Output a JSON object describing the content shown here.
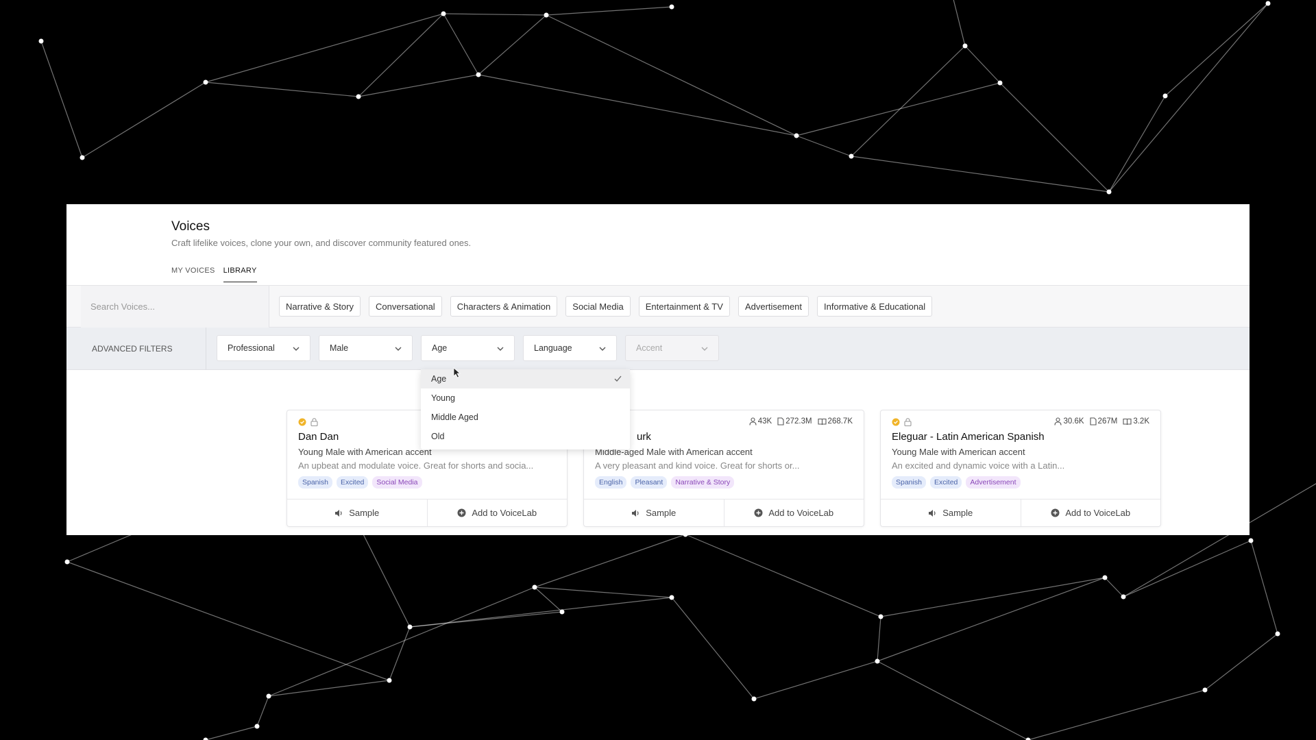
{
  "header": {
    "title": "Voices",
    "subtitle": "Craft lifelike voices, clone your own, and discover community featured ones."
  },
  "tabs": [
    {
      "label": "MY VOICES",
      "active": false
    },
    {
      "label": "LIBRARY",
      "active": true
    }
  ],
  "search": {
    "placeholder": "Search Voices..."
  },
  "categories": [
    "Narrative & Story",
    "Conversational",
    "Characters & Animation",
    "Social Media",
    "Entertainment & TV",
    "Advertisement",
    "Informative & Educational"
  ],
  "advanced_filters": {
    "label": "ADVANCED FILTERS",
    "selects": [
      {
        "value": "Professional",
        "disabled": false
      },
      {
        "value": "Male",
        "disabled": false
      },
      {
        "value": "Age",
        "disabled": false,
        "open": true
      },
      {
        "value": "Language",
        "disabled": false
      },
      {
        "value": "Accent",
        "disabled": true
      }
    ]
  },
  "age_dropdown": {
    "options": [
      "Age",
      "Young",
      "Middle Aged",
      "Old"
    ],
    "selected": "Age"
  },
  "cards": [
    {
      "name": "Dan Dan",
      "verified": true,
      "locked": true,
      "stats": [],
      "desc1": "Young Male with American accent",
      "desc2": "An upbeat and modulate voice. Great for shorts and socia...",
      "tags": [
        {
          "label": "Spanish",
          "color": "blue"
        },
        {
          "label": "Excited",
          "color": "blue"
        },
        {
          "label": "Social Media",
          "color": "purple"
        }
      ],
      "sample_label": "Sample",
      "add_label": "Add to VoiceLab"
    },
    {
      "name": "urk",
      "verified": false,
      "locked": false,
      "stats": [
        {
          "icon": "user-icon",
          "value": "43K"
        },
        {
          "icon": "file-icon",
          "value": "272.3M"
        },
        {
          "icon": "book-icon",
          "value": "268.7K"
        }
      ],
      "desc1": "Middle-aged Male with American accent",
      "desc2": "A very pleasant and kind voice. Great for shorts or...",
      "tags": [
        {
          "label": "English",
          "color": "blue"
        },
        {
          "label": "Pleasant",
          "color": "blue"
        },
        {
          "label": "Narrative & Story",
          "color": "purple"
        }
      ],
      "sample_label": "Sample",
      "add_label": "Add to VoiceLab"
    },
    {
      "name": "Eleguar - Latin American Spanish",
      "verified": true,
      "locked": true,
      "stats": [
        {
          "icon": "user-icon",
          "value": "30.6K"
        },
        {
          "icon": "file-icon",
          "value": "267M"
        },
        {
          "icon": "book-icon",
          "value": "3.2K"
        }
      ],
      "desc1": "Young Male with American accent",
      "desc2": "An excited and dynamic voice with a Latin...",
      "tags": [
        {
          "label": "Spanish",
          "color": "blue"
        },
        {
          "label": "Excited",
          "color": "blue"
        },
        {
          "label": "Advertisement",
          "color": "purple"
        }
      ],
      "sample_label": "Sample",
      "add_label": "Add to VoiceLab"
    }
  ]
}
